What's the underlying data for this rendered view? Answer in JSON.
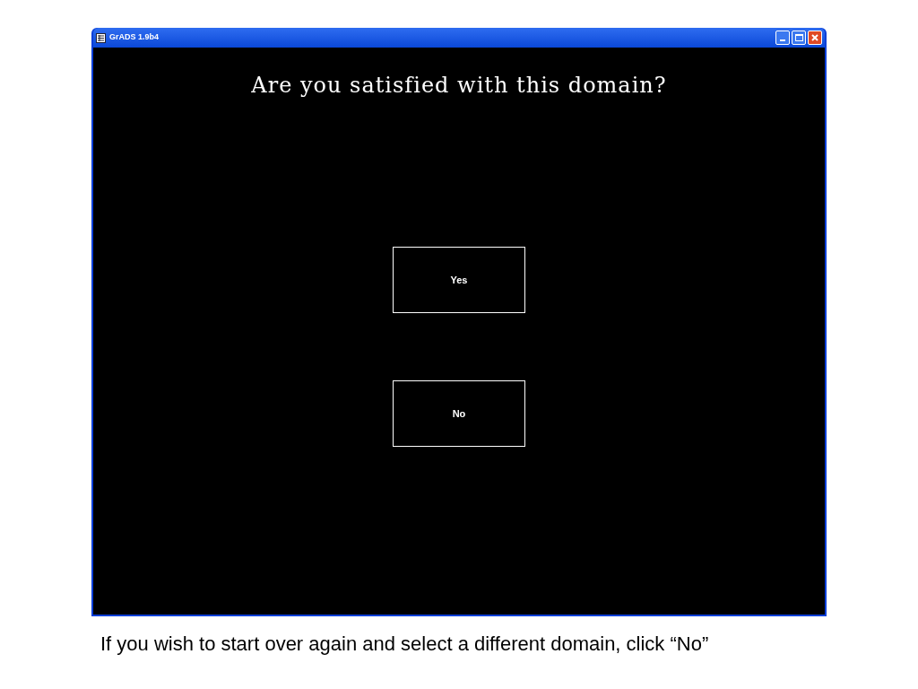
{
  "window": {
    "title": "GrADS 1.9b4"
  },
  "prompt": "Are you satisfied with this domain?",
  "buttons": [
    "Yes",
    "No"
  ],
  "caption": "If you wish to start over again and select a different domain, click “No”"
}
